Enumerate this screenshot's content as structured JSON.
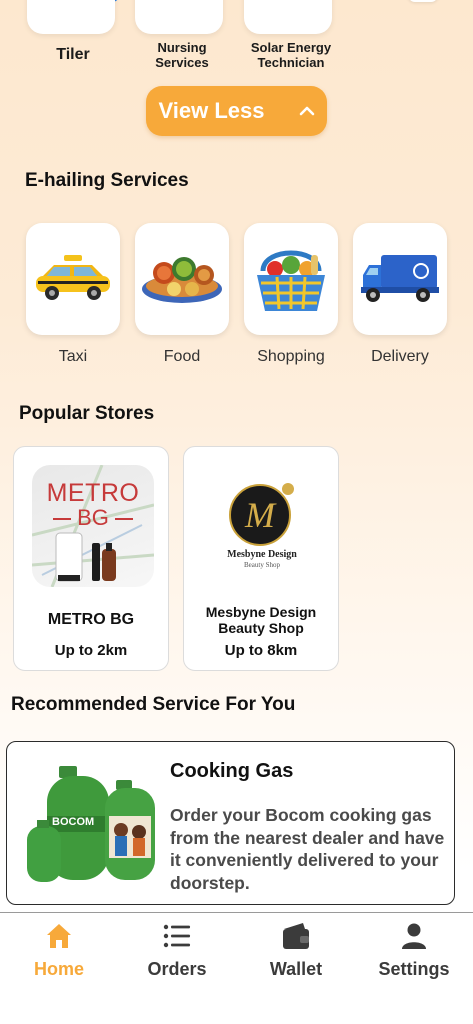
{
  "top_services": [
    {
      "label": "Tiler"
    },
    {
      "label": "Nursing Services"
    },
    {
      "label": "Solar Energy Technician"
    }
  ],
  "view_less_label": "View Less",
  "ehailing": {
    "title": "E-hailing Services",
    "items": [
      {
        "label": "Taxi",
        "icon": "taxi-icon"
      },
      {
        "label": "Food",
        "icon": "food-platter-icon"
      },
      {
        "label": "Shopping",
        "icon": "shopping-basket-icon"
      },
      {
        "label": "Delivery",
        "icon": "delivery-truck-icon"
      }
    ]
  },
  "popular_stores": {
    "title": "Popular Stores",
    "stores": [
      {
        "name": "METRO BG",
        "distance": "Up to 2km",
        "logo_lines": [
          "METRO",
          "BG"
        ]
      },
      {
        "name": "Mesbyne Design Beauty Shop",
        "distance": "Up to 8km",
        "logo_text": "Mesbyne Design",
        "logo_sub": "Beauty Shop"
      }
    ]
  },
  "recommended": {
    "title": "Recommended Service For You",
    "card": {
      "title": "Cooking Gas",
      "description": "Order your Bocom cooking gas from the nearest dealer and have it conveniently delivered to your doorstep.",
      "brand": "BOCOM"
    }
  },
  "bottom_nav": [
    {
      "label": "Home",
      "icon": "home-icon",
      "active": true
    },
    {
      "label": "Orders",
      "icon": "list-icon",
      "active": false
    },
    {
      "label": "Wallet",
      "icon": "wallet-icon",
      "active": false
    },
    {
      "label": "Settings",
      "icon": "person-icon",
      "active": false
    }
  ],
  "colors": {
    "accent": "#f7a93a",
    "text": "#111111",
    "muted": "#4a4a4a"
  }
}
